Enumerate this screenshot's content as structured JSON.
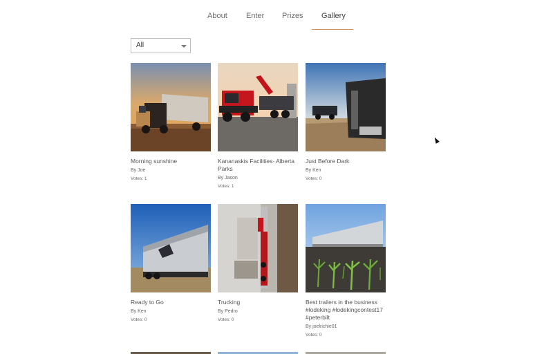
{
  "nav": {
    "items": [
      {
        "label": "About",
        "active": false
      },
      {
        "label": "Enter",
        "active": false
      },
      {
        "label": "Prizes",
        "active": false
      },
      {
        "label": "Gallery",
        "active": true
      }
    ],
    "active_color": "#c98a5a"
  },
  "filter": {
    "value": "All"
  },
  "gallery": [
    {
      "title": "Morning sunshine",
      "author": "By Joe",
      "votes": "Votes: 1"
    },
    {
      "title": "Kananaskis Facilities- Alberta Parks",
      "author": "By Jason",
      "votes": "Votes: 1"
    },
    {
      "title": "Just Before Dark",
      "author": "By Ken",
      "votes": "Votes: 0"
    },
    {
      "title": "Ready to Go",
      "author": "By Ken",
      "votes": "Votes: 0"
    },
    {
      "title": "Trucking",
      "author": "By Pedro",
      "votes": "Votes: 0"
    },
    {
      "title": "Best trailers in the business #lodeking #lodekingcontest17 #peterbilt",
      "author": "By joelrichie01",
      "votes": "Votes: 0"
    }
  ]
}
